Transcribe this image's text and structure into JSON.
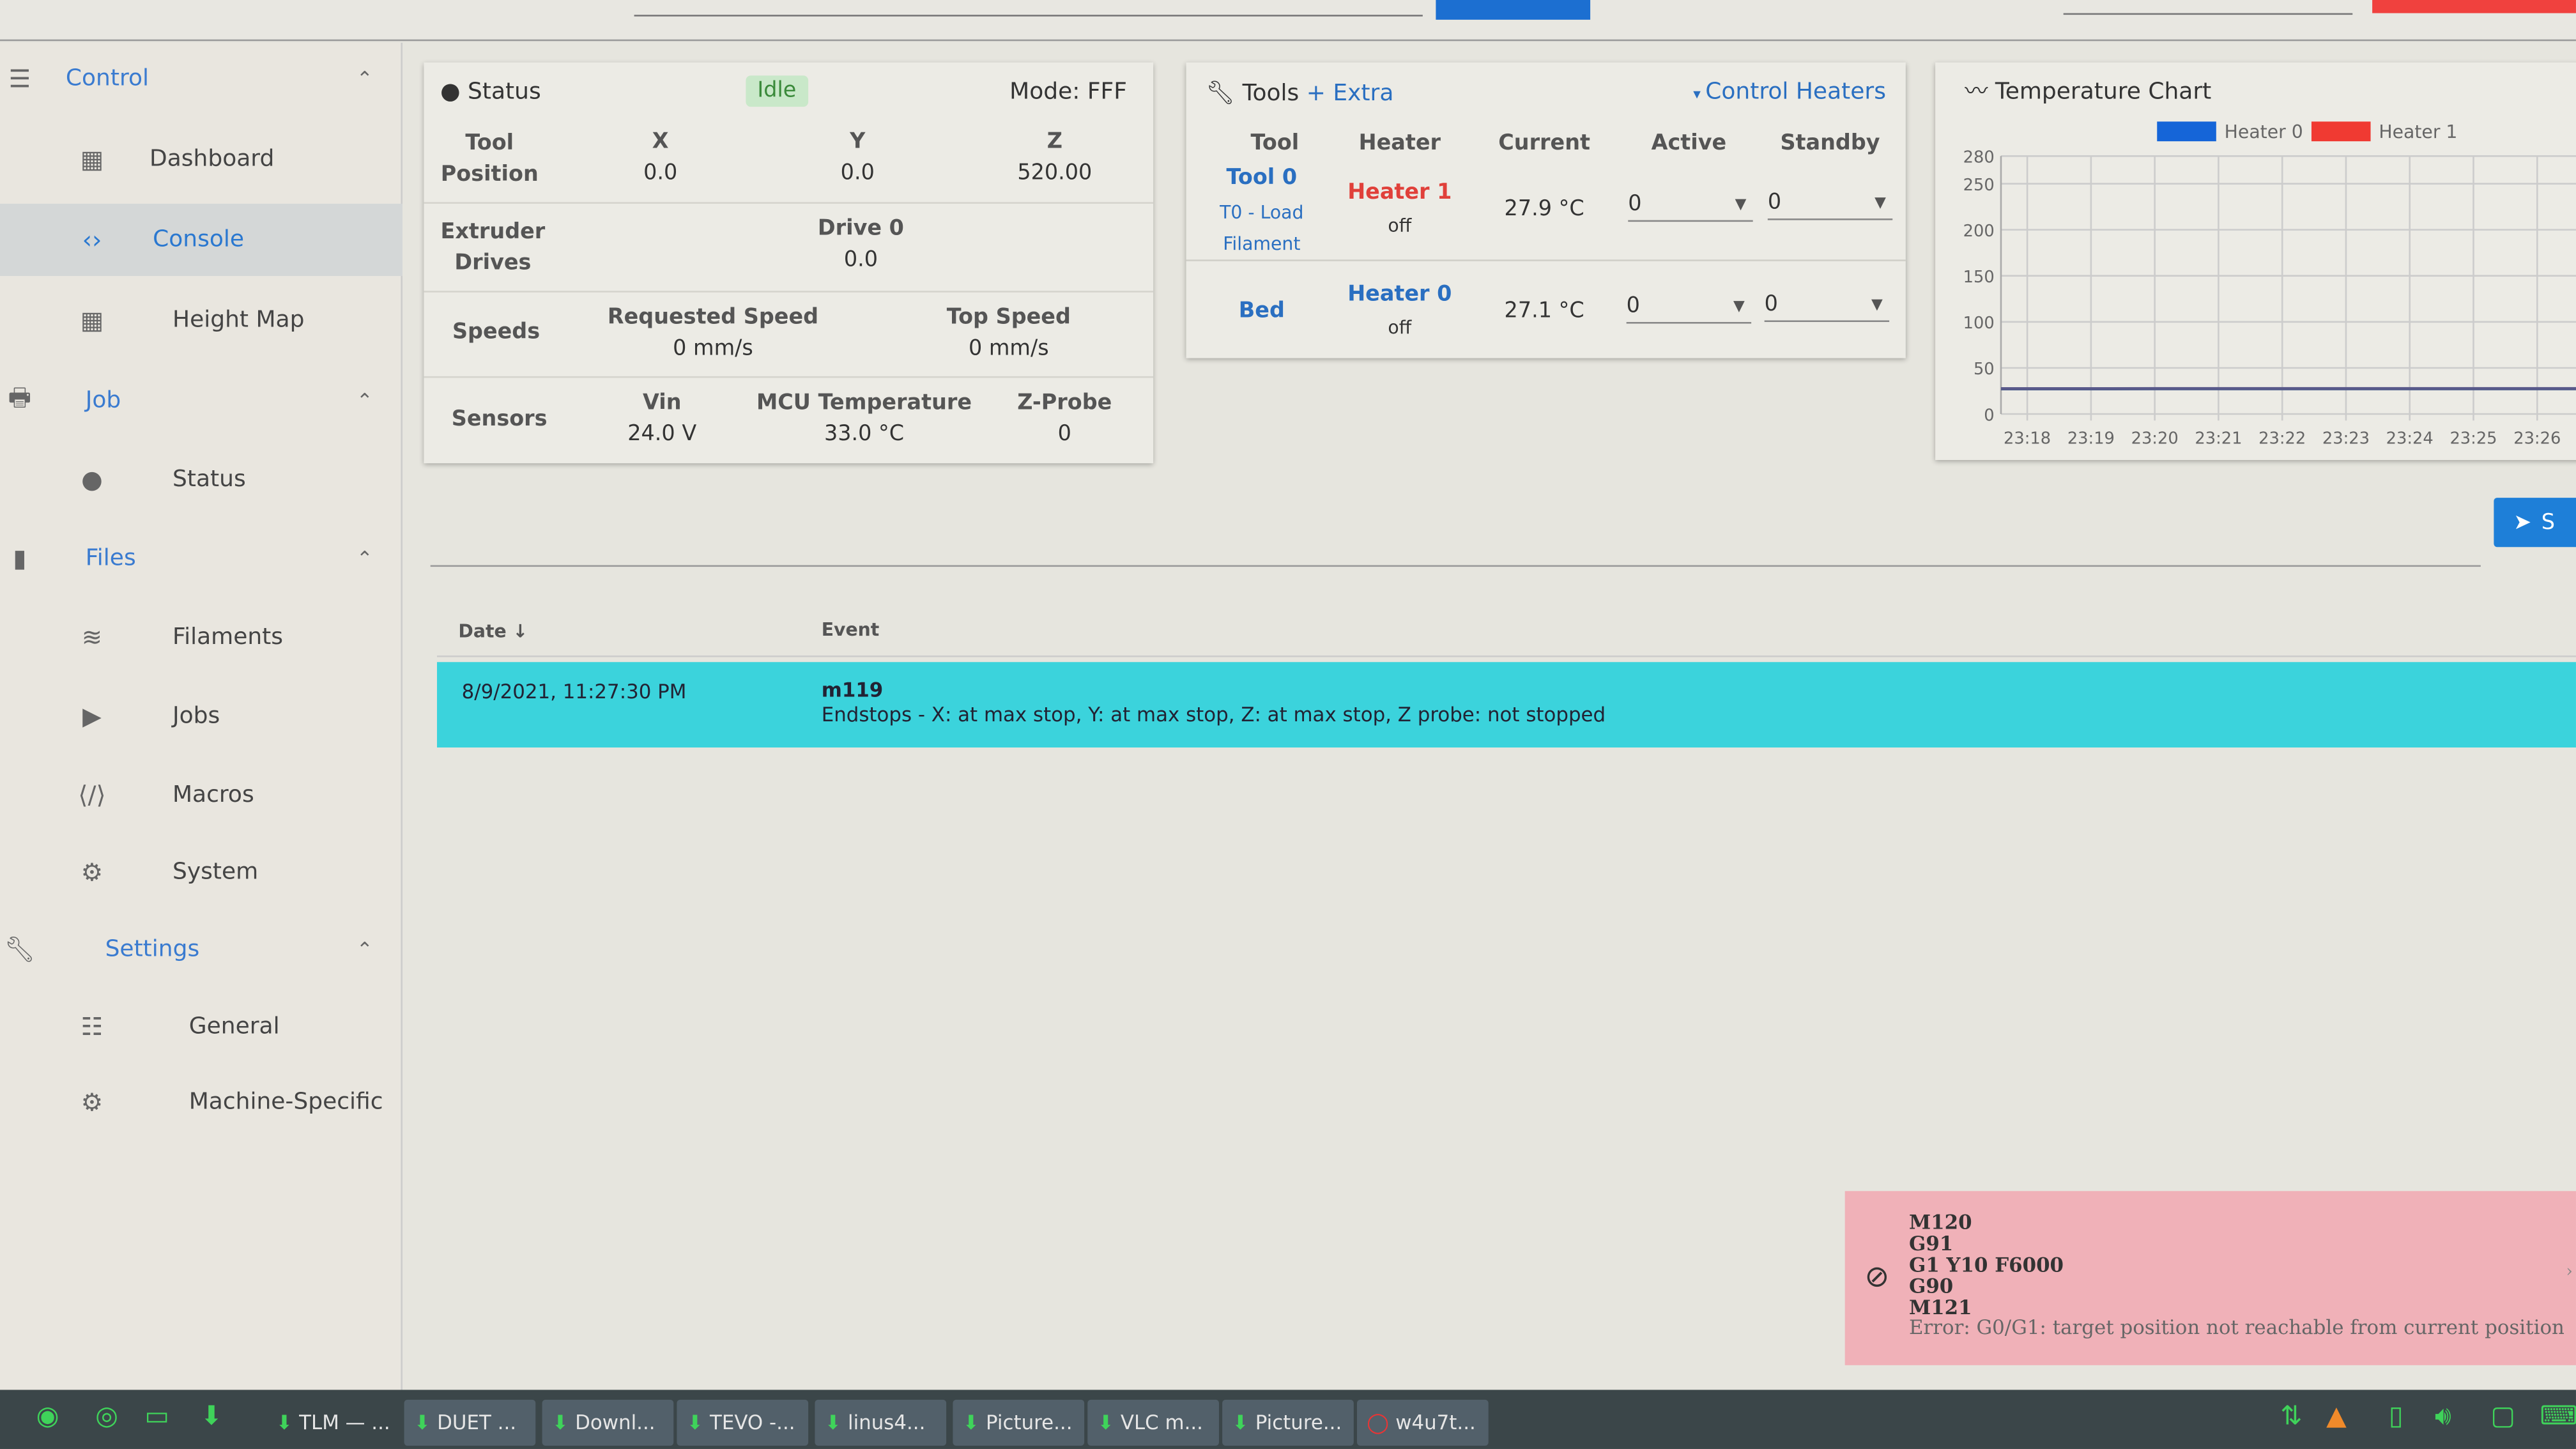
{
  "sidebar": {
    "items": [
      {
        "label": "Control",
        "icon": "sliders-icon",
        "group": true
      },
      {
        "label": "Dashboard",
        "icon": "dashboard-icon"
      },
      {
        "label": "Console",
        "icon": "code-icon",
        "active": true
      },
      {
        "label": "Height Map",
        "icon": "grid-icon"
      },
      {
        "label": "Job",
        "icon": "printer-icon",
        "group": true
      },
      {
        "label": "Status",
        "icon": "info-icon"
      },
      {
        "label": "Files",
        "icon": "sd-card-icon",
        "group": true
      },
      {
        "label": "Filaments",
        "icon": "database-icon"
      },
      {
        "label": "Jobs",
        "icon": "play-icon"
      },
      {
        "label": "Macros",
        "icon": "code-tags-icon"
      },
      {
        "label": "System",
        "icon": "gear-icon"
      },
      {
        "label": "Settings",
        "icon": "wrench-icon",
        "group": true
      },
      {
        "label": "General",
        "icon": "tune-icon"
      },
      {
        "label": "Machine-Specific",
        "icon": "gears-icon"
      }
    ]
  },
  "status": {
    "title": "Status",
    "state": "Idle",
    "mode": "Mode: FFF",
    "tool_position": {
      "label": "Tool Position",
      "axes": [
        {
          "name": "X",
          "value": "0.0"
        },
        {
          "name": "Y",
          "value": "0.0"
        },
        {
          "name": "Z",
          "value": "520.00"
        }
      ]
    },
    "extruder": {
      "label": "Extruder Drives",
      "drive": "Drive 0",
      "value": "0.0"
    },
    "speeds": {
      "label": "Speeds",
      "requested_label": "Requested Speed",
      "requested": "0 mm/s",
      "top_label": "Top Speed",
      "top": "0 mm/s"
    },
    "sensors": {
      "label": "Sensors",
      "vin_label": "Vin",
      "vin": "24.0 V",
      "mcu_label": "MCU Temperature",
      "mcu": "33.0 °C",
      "probe_label": "Z-Probe",
      "probe": "0"
    }
  },
  "tools": {
    "title": "Tools",
    "extra": "+ Extra",
    "control": "Control Heaters",
    "headers": [
      "Tool",
      "Heater",
      "Current",
      "Active",
      "Standby"
    ],
    "rows": [
      {
        "tool": "Tool 0",
        "sub": "T0 - Load Filament",
        "heater": "Heater 1",
        "heater_state": "off",
        "current": "27.9 °C",
        "active": "0",
        "standby": "0"
      },
      {
        "tool": "Bed",
        "heater": "Heater 0",
        "heater_state": "off",
        "current": "27.1 °C",
        "active": "0",
        "standby": "0"
      }
    ]
  },
  "chart_data": {
    "type": "line",
    "title": "Temperature Chart",
    "legend": [
      {
        "name": "Heater 0",
        "color": "#1565d8"
      },
      {
        "name": "Heater 1",
        "color": "#f03a32"
      }
    ],
    "legend_placement": "top",
    "grid": true,
    "x": [
      "23:18",
      "23:19",
      "23:20",
      "23:21",
      "23:22",
      "23:23",
      "23:24",
      "23:25",
      "23:26"
    ],
    "yticks": [
      0,
      50,
      100,
      150,
      200,
      250,
      280
    ],
    "ylim": [
      0,
      280
    ],
    "series": [
      {
        "name": "Heater 0",
        "values": [
          27,
          27,
          27.1,
          27.1,
          27.1,
          27.1,
          27.1,
          27.1,
          27.1
        ]
      },
      {
        "name": "Heater 1",
        "values": [
          27.8,
          27.8,
          27.9,
          27.9,
          27.9,
          27.9,
          27.9,
          27.9,
          27.9
        ]
      }
    ]
  },
  "console": {
    "input_value": "",
    "send_label": "S",
    "headers": {
      "date": "Date ↓",
      "event": "Event"
    },
    "rows": [
      {
        "date": "8/9/2021, 11:27:30 PM",
        "command": "m119",
        "message": "Endstops - X: at max stop, Y: at max stop, Z: at max stop, Z probe: not stopped"
      }
    ]
  },
  "toast": {
    "lines": [
      "M120",
      "G91",
      "G1 Y10 F6000",
      "G90",
      "M121"
    ],
    "error": "Error: G0/G1: target position not reachable from current position",
    "icon": "block-icon"
  },
  "taskbar": {
    "items": [
      "TLM — ...",
      "DUET ...",
      "Downl...",
      "TEVO -...",
      "linus4...",
      "Picture...",
      "VLC m...",
      "Picture...",
      "w4u7t..."
    ]
  },
  "colors": {
    "accent": "#2a78d0",
    "row_highlight": "#3bd3dc",
    "error_bg": "#f0b1b8",
    "stop": "#f0413e"
  }
}
